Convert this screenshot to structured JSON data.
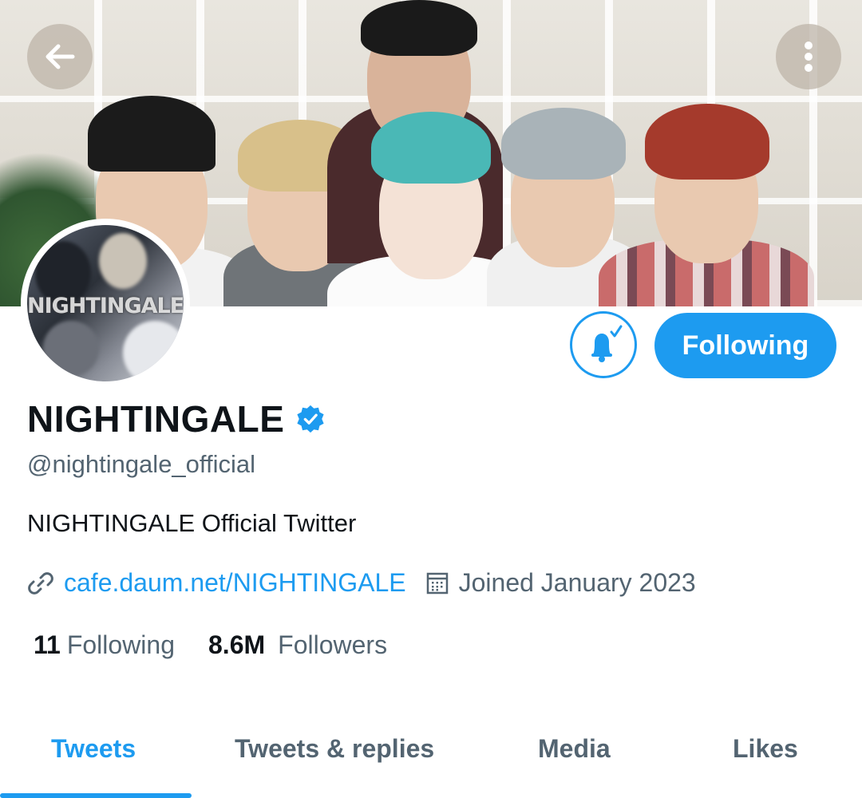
{
  "profile": {
    "name": "NIGHTINGALE",
    "handle": "@nightingale_official",
    "bio": "NIGHTINGALE Official Twitter",
    "website": "cafe.daum.net/NIGHTINGALE",
    "joined": "Joined January 2023",
    "avatar_watermark": "NIGHTINGALE",
    "verified": true
  },
  "stats": {
    "following_count": "11",
    "following_label": "Following",
    "followers_count": "8.6M",
    "followers_label": "Followers"
  },
  "actions": {
    "follow_button_label": "Following",
    "notify_icon": "bell-check-icon"
  },
  "nav": {
    "back_icon": "arrow-left-icon",
    "more_icon": "more-vertical-icon"
  },
  "tabs": [
    {
      "label": "Tweets",
      "active": true
    },
    {
      "label": "Tweets & replies",
      "active": false
    },
    {
      "label": "Media",
      "active": false
    },
    {
      "label": "Likes",
      "active": false
    }
  ],
  "colors": {
    "accent": "#1d9bf0",
    "text_primary": "#0f1419",
    "text_secondary": "#536471"
  }
}
